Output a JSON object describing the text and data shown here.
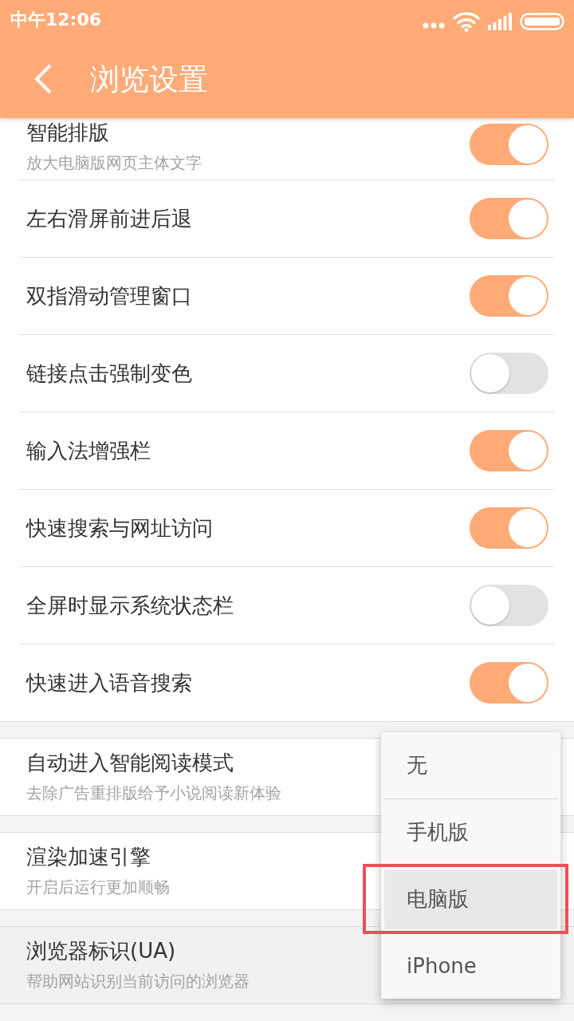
{
  "status_bar": {
    "time": "中午12:06"
  },
  "app_bar": {
    "title": "浏览设置"
  },
  "groups": [
    {
      "items": [
        {
          "kind": "toggle",
          "title": "智能排版",
          "subtitle": "放大电脑版网页主体文字",
          "on": true,
          "pressed": false
        },
        {
          "kind": "toggle",
          "title": "左右滑屏前进后退",
          "on": true,
          "pressed": false
        },
        {
          "kind": "toggle",
          "title": "双指滑动管理窗口",
          "on": true,
          "pressed": false
        },
        {
          "kind": "toggle",
          "title": "链接点击强制变色",
          "on": false,
          "pressed": false
        },
        {
          "kind": "toggle",
          "title": "输入法增强栏",
          "on": true,
          "pressed": false
        },
        {
          "kind": "toggle",
          "title": "快速搜索与网址访问",
          "on": true,
          "pressed": false
        },
        {
          "kind": "toggle",
          "title": "全屏时显示系统状态栏",
          "on": false,
          "pressed": false
        },
        {
          "kind": "toggle",
          "title": "快速进入语音搜索",
          "on": true,
          "pressed": false
        }
      ]
    },
    {
      "items": [
        {
          "kind": "plain",
          "title": "自动进入智能阅读模式",
          "subtitle": "去除广告重排版给予小说阅读新体验",
          "pressed": false
        }
      ]
    },
    {
      "items": [
        {
          "kind": "plain",
          "title": "渲染加速引擎",
          "subtitle": "开启后运行更加顺畅",
          "pressed": false
        }
      ]
    },
    {
      "items": [
        {
          "kind": "plain",
          "title": "浏览器标识(UA)",
          "subtitle": "帮助网站识别当前访问的浏览器",
          "pressed": true
        }
      ]
    }
  ],
  "popup_menu": {
    "items": [
      {
        "label": "无",
        "selected": false,
        "marked": false
      },
      {
        "label": "手机版",
        "selected": false,
        "marked": false
      },
      {
        "label": "电脑版",
        "selected": true,
        "marked": true
      },
      {
        "label": "iPhone",
        "selected": false,
        "marked": false
      }
    ]
  }
}
